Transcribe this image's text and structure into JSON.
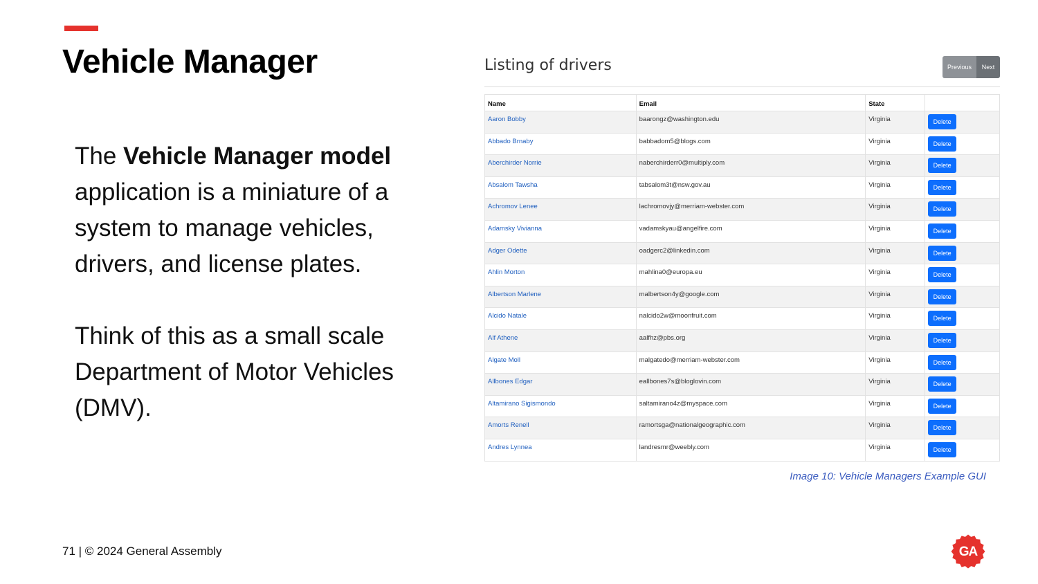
{
  "slide": {
    "title": "Vehicle Manager",
    "para1_prefix": "The ",
    "para1_bold": "Vehicle Manager model",
    "para1_suffix": " application is a miniature of a system to manage vehicles, drivers, and license plates.",
    "para2": "Think of this as a small scale Department of Motor Vehicles (DMV).",
    "caption": "Image 10: Vehicle Managers Example GUI",
    "footer": "71 | © 2024 General Assembly",
    "logo_text": "GA"
  },
  "listing": {
    "title": "Listing of drivers",
    "prev_label": "Previous",
    "next_label": "Next",
    "columns": [
      "Name",
      "Email",
      "State",
      ""
    ],
    "delete_label": "Delete",
    "rows": [
      {
        "name": "Aaron Bobby",
        "email": "baarongz@washington.edu",
        "state": "Virginia"
      },
      {
        "name": "Abbado Brnaby",
        "email": "babbadom5@blogs.com",
        "state": "Virginia"
      },
      {
        "name": "Aberchirder Norrie",
        "email": "naberchirderr0@multiply.com",
        "state": "Virginia"
      },
      {
        "name": "Absalom Tawsha",
        "email": "tabsalom3t@nsw.gov.au",
        "state": "Virginia"
      },
      {
        "name": "Achromov Lenee",
        "email": "lachromovjy@merriam-webster.com",
        "state": "Virginia"
      },
      {
        "name": "Adamsky Vivianna",
        "email": "vadamskyau@angelfire.com",
        "state": "Virginia"
      },
      {
        "name": "Adger Odette",
        "email": "oadgerc2@linkedin.com",
        "state": "Virginia"
      },
      {
        "name": "Ahlin Morton",
        "email": "mahlina0@europa.eu",
        "state": "Virginia"
      },
      {
        "name": "Albertson Marlene",
        "email": "malbertson4y@google.com",
        "state": "Virginia"
      },
      {
        "name": "Alcido Natale",
        "email": "nalcido2w@moonfruit.com",
        "state": "Virginia"
      },
      {
        "name": "Alf Athene",
        "email": "aalfhz@pbs.org",
        "state": "Virginia"
      },
      {
        "name": "Algate Moll",
        "email": "malgatedo@merriam-webster.com",
        "state": "Virginia"
      },
      {
        "name": "Allbones Edgar",
        "email": "eallbones7s@bloglovin.com",
        "state": "Virginia"
      },
      {
        "name": "Altamirano Sigismondo",
        "email": "saltamirano4z@myspace.com",
        "state": "Virginia"
      },
      {
        "name": "Amorts Renell",
        "email": "ramortsga@nationalgeographic.com",
        "state": "Virginia"
      },
      {
        "name": "Andres Lynnea",
        "email": "landresmr@weebly.com",
        "state": "Virginia"
      }
    ]
  },
  "colors": {
    "accent": "#e5322d",
    "link": "#1f5fbf",
    "button": "#0d6efd",
    "caption": "#3a5bbf"
  }
}
